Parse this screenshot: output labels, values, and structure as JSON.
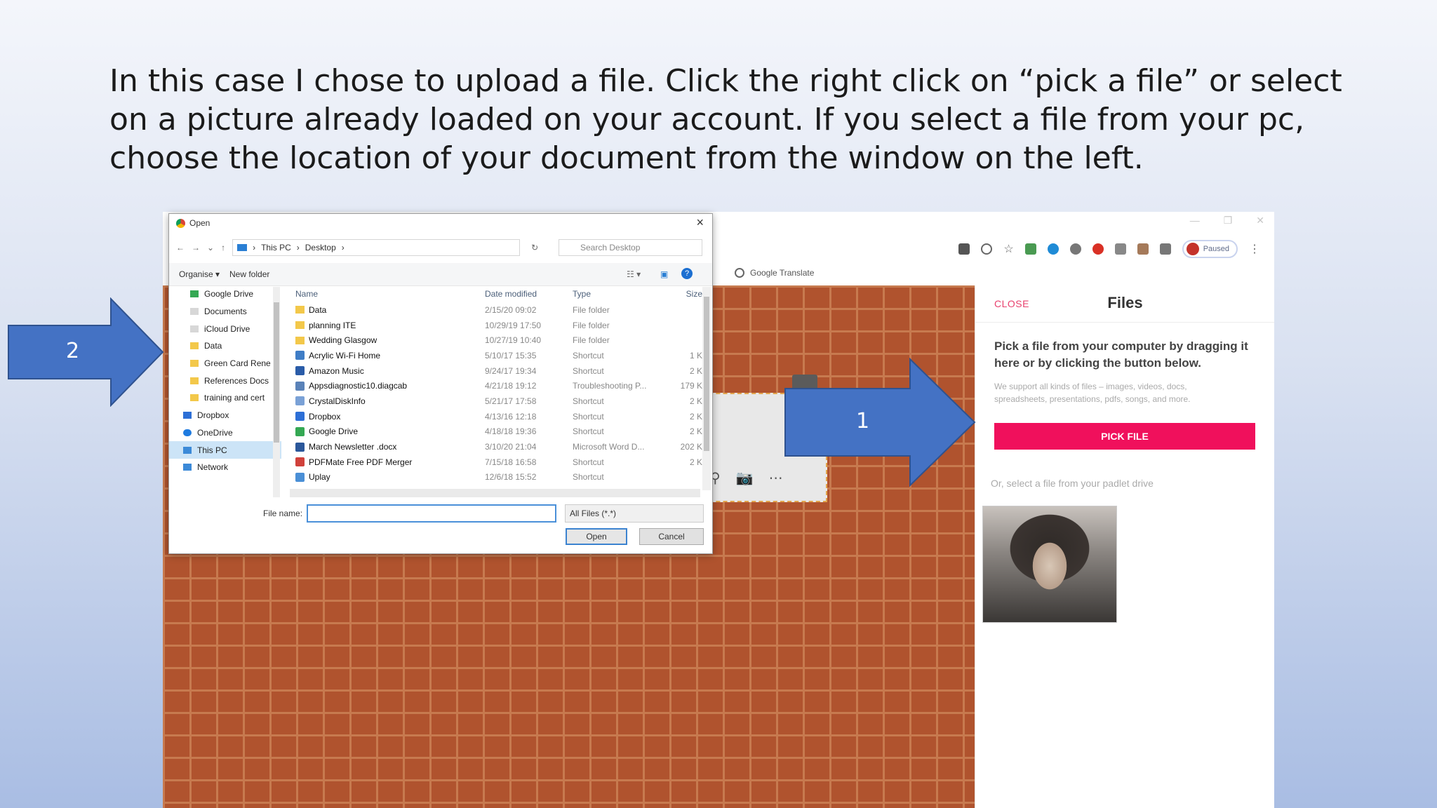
{
  "caption": "In this case I chose to upload a file. Click the right click on “pick a file” or select on a picture already loaded on your account. If you select a file from your pc, choose the location of your document from the window on the left.",
  "arrows": {
    "one": "1",
    "two": "2"
  },
  "browser": {
    "bookmark": "Google Translate",
    "profile_status": "Paused"
  },
  "padlet": {
    "close": "CLOSE",
    "title": "Files",
    "pick_title": "Pick a file from your computer by dragging it here or by clicking the button below.",
    "pick_sub": "We support all kinds of files – images, videos, docs, spreadsheets, presentations, pdfs, songs, and more.",
    "pick_button": "PICK FILE",
    "or_select": "Or, select a file from your padlet drive"
  },
  "dialog": {
    "title": "Open",
    "path": {
      "root": "This PC",
      "folder": "Desktop"
    },
    "search_placeholder": "Search Desktop",
    "organise": "Organise ▾",
    "new_folder": "New folder",
    "nav": [
      "Google Drive",
      "Documents",
      "iCloud Drive",
      "Data",
      "Green Card Rene",
      "References Docs",
      "training and cert",
      "Dropbox",
      "OneDrive",
      "This PC",
      "Network"
    ],
    "columns": {
      "name": "Name",
      "date": "Date modified",
      "type": "Type",
      "size": "Size"
    },
    "files": [
      {
        "name": "Data",
        "date": "2/15/20 09:02",
        "type": "File folder",
        "size": ""
      },
      {
        "name": "planning ITE",
        "date": "10/29/19 17:50",
        "type": "File folder",
        "size": ""
      },
      {
        "name": "Wedding Glasgow",
        "date": "10/27/19 10:40",
        "type": "File folder",
        "size": ""
      },
      {
        "name": "Acrylic Wi-Fi Home",
        "date": "5/10/17 15:35",
        "type": "Shortcut",
        "size": "1 K"
      },
      {
        "name": "Amazon Music",
        "date": "9/24/17 19:34",
        "type": "Shortcut",
        "size": "2 K"
      },
      {
        "name": "Appsdiagnostic10.diagcab",
        "date": "4/21/18 19:12",
        "type": "Troubleshooting P...",
        "size": "179 K"
      },
      {
        "name": "CrystalDiskInfo",
        "date": "5/21/17 17:58",
        "type": "Shortcut",
        "size": "2 K"
      },
      {
        "name": "Dropbox",
        "date": "4/13/16 12:18",
        "type": "Shortcut",
        "size": "2 K"
      },
      {
        "name": "Google Drive",
        "date": "4/18/18 19:36",
        "type": "Shortcut",
        "size": "2 K"
      },
      {
        "name": "March Newsletter .docx",
        "date": "3/10/20 21:04",
        "type": "Microsoft Word D...",
        "size": "202 K"
      },
      {
        "name": "PDFMate Free PDF Merger",
        "date": "7/15/18 16:58",
        "type": "Shortcut",
        "size": "2 K"
      },
      {
        "name": "Uplay",
        "date": "12/6/18 15:52",
        "type": "Shortcut",
        "size": ""
      }
    ],
    "file_name_label": "File name:",
    "file_name_value": "",
    "filter": "All Files (*.*)",
    "open_button": "Open",
    "cancel_button": "Cancel"
  }
}
